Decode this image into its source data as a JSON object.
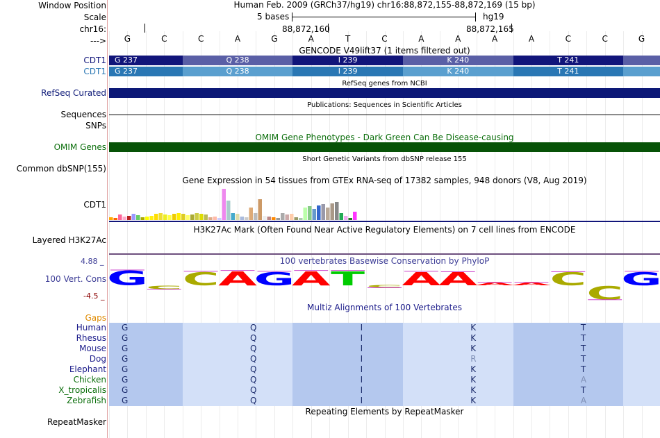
{
  "header": {
    "window_position_label": "Window Position",
    "scale_label": "Scale",
    "chrom_label": "chr16:",
    "arrow_label": "--->",
    "assembly_text": "Human Feb. 2009 (GRCh37/hg19)   chr16:88,872,155-88,872,169 (15 bp)",
    "scale_text": "5 bases",
    "db_text": "hg19",
    "coord_a": "88,872,160",
    "coord_b": "88,872,165"
  },
  "sequence": [
    "G",
    "C",
    "C",
    "A",
    "G",
    "A",
    "T",
    "C",
    "A",
    "A",
    "A",
    "A",
    "C",
    "C",
    "G"
  ],
  "gencode": {
    "title": "GENCODE V49lift37 (1 items filtered out)",
    "label1": "CDT1",
    "label2": "CDT1",
    "row1": [
      "G 237",
      "Q 238",
      "I 239",
      "K 240",
      "T 241"
    ],
    "row2": [
      "G 237",
      "Q 238",
      "I 239",
      "K 240",
      "T 241"
    ],
    "color_dark": "#11157a",
    "color_mid": "#5a5fa6",
    "color_light2": "#5a9fcf",
    "color_dark2": "#2a77b4"
  },
  "refseq": {
    "subtitle": "RefSeq genes from NCBI",
    "label": "RefSeq Curated",
    "color": "#0c1877"
  },
  "publications": {
    "subtitle": "Publications: Sequences in Scientific Articles",
    "label1": "Sequences",
    "label2": "SNPs"
  },
  "omim": {
    "subtitle": "OMIM Gene Phenotypes - Dark Green Can Be Disease-causing",
    "label": "OMIM Genes",
    "color": "#075207",
    "label_color": "#0b6e0b"
  },
  "dbsnp": {
    "subtitle": "Short Genetic Variants from dbSNP release 155",
    "label": "Common dbSNP(155)"
  },
  "gtex": {
    "subtitle": "Gene Expression in 54 tissues from GTEx RNA-seq of 17382 samples, 948 donors (V8, Aug 2019)",
    "label": "CDT1",
    "values": [
      4,
      3,
      8,
      5,
      6,
      9,
      7,
      4,
      5,
      6,
      9,
      10,
      8,
      7,
      9,
      10,
      9,
      7,
      8,
      10,
      9,
      8,
      4,
      5,
      3,
      45,
      28,
      10,
      9,
      5,
      4,
      18,
      10,
      30,
      6,
      5,
      4,
      3,
      10,
      8,
      9,
      4,
      3,
      18,
      20,
      16,
      21,
      23,
      18,
      24,
      26,
      10,
      6,
      3,
      12
    ],
    "colors": [
      "#ffaa00",
      "#ff6600",
      "#ff6699",
      "#ffaacc",
      "#bb2222",
      "#9999ff",
      "#66cc66",
      "#aaaa00",
      "#ffff00",
      "#ffee11",
      "#ffdd00",
      "#eedd33",
      "#eeee22",
      "#ffff44",
      "#eecc00",
      "#ffee00",
      "#ddcc22",
      "#ffff66",
      "#aaaa33",
      "#cccc44",
      "#dddd00",
      "#bbbb55",
      "#ddaa88",
      "#ffbbaa",
      "#ccccff",
      "#ee88ee",
      "#aacccc",
      "#44aacc",
      "#ddddaa",
      "#aabbdd",
      "#cccccc",
      "#ddaa77",
      "#bbbbbb",
      "#cc9966",
      "#eeeeee",
      "#bb8888",
      "#ff8800",
      "#999999",
      "#aaaaaa",
      "#ccaaaa",
      "#ffccaa",
      "#999966",
      "#aaccaa",
      "#bbffaa",
      "#88cc88",
      "#6699cc",
      "#3366cc",
      "#9999aa",
      "#bbaa99",
      "#aa9988",
      "#888888",
      "#22aa55",
      "#eeaaee",
      "#227722",
      "#ff33ff"
    ]
  },
  "h3k27ac": {
    "subtitle": "H3K27Ac Mark (Often Found Near Active Regulatory Elements) on 7 cell lines from ENCODE",
    "label": "Layered H3K27Ac"
  },
  "conservation": {
    "subtitle": "100 vertebrates Basewise Conservation by PhyloP",
    "label": "100 Vert. Cons",
    "max_label": "4.88 _",
    "min_label": "-4.5 _",
    "color": "#3c3c96",
    "bases": [
      "G",
      "C",
      "C",
      "A",
      "G",
      "A",
      "T",
      "C",
      "A",
      "A",
      "A",
      "A",
      "C",
      "C",
      "G"
    ],
    "scores": [
      3.5,
      -1.0,
      3.2,
      3.4,
      3.2,
      3.4,
      3.4,
      -0.4,
      3.2,
      3.1,
      0.6,
      0.6,
      3.1,
      -3.8,
      3.2
    ],
    "base_colors": {
      "A": "#ff0000",
      "C": "#aaaa00",
      "G": "#0000ff",
      "T": "#00cc00"
    }
  },
  "multiz": {
    "subtitle": "Multiz Alignments of 100 Vertebrates",
    "gaps_label": "Gaps",
    "gaps_color": "#e08a00",
    "species": [
      {
        "name": "Human",
        "aas": [
          "G",
          "Q",
          "I",
          "K",
          "T"
        ]
      },
      {
        "name": "Rhesus",
        "aas": [
          "G",
          "Q",
          "I",
          "K",
          "T"
        ]
      },
      {
        "name": "Mouse",
        "aas": [
          "G",
          "Q",
          "I",
          "K",
          "T"
        ]
      },
      {
        "name": "Dog",
        "aas": [
          "G",
          "Q",
          "I",
          "R",
          "T"
        ]
      },
      {
        "name": "Elephant",
        "aas": [
          "G",
          "Q",
          "I",
          "K",
          "T"
        ]
      },
      {
        "name": "Chicken",
        "aas": [
          "G",
          "Q",
          "I",
          "K",
          "A"
        ]
      },
      {
        "name": "X_tropicalis",
        "aas": [
          "G",
          "Q",
          "I",
          "K",
          "T"
        ]
      },
      {
        "name": "Zebrafish",
        "aas": [
          "G",
          "Q",
          "I",
          "K",
          "A"
        ]
      }
    ],
    "mismatch": [
      [],
      [],
      [],
      [
        3
      ],
      [],
      [
        4
      ],
      [],
      [
        4
      ]
    ],
    "colors": {
      "mammal": "#1b1b8a",
      "vertebrate": "#0b6e0b",
      "shade_dark": "#b4c8ee",
      "shade_light": "#d3e0f8",
      "mismatch": "#7f8fb5"
    }
  },
  "repeatmasker": {
    "subtitle": "Repeating Elements by RepeatMasker",
    "label": "RepeatMasker"
  }
}
